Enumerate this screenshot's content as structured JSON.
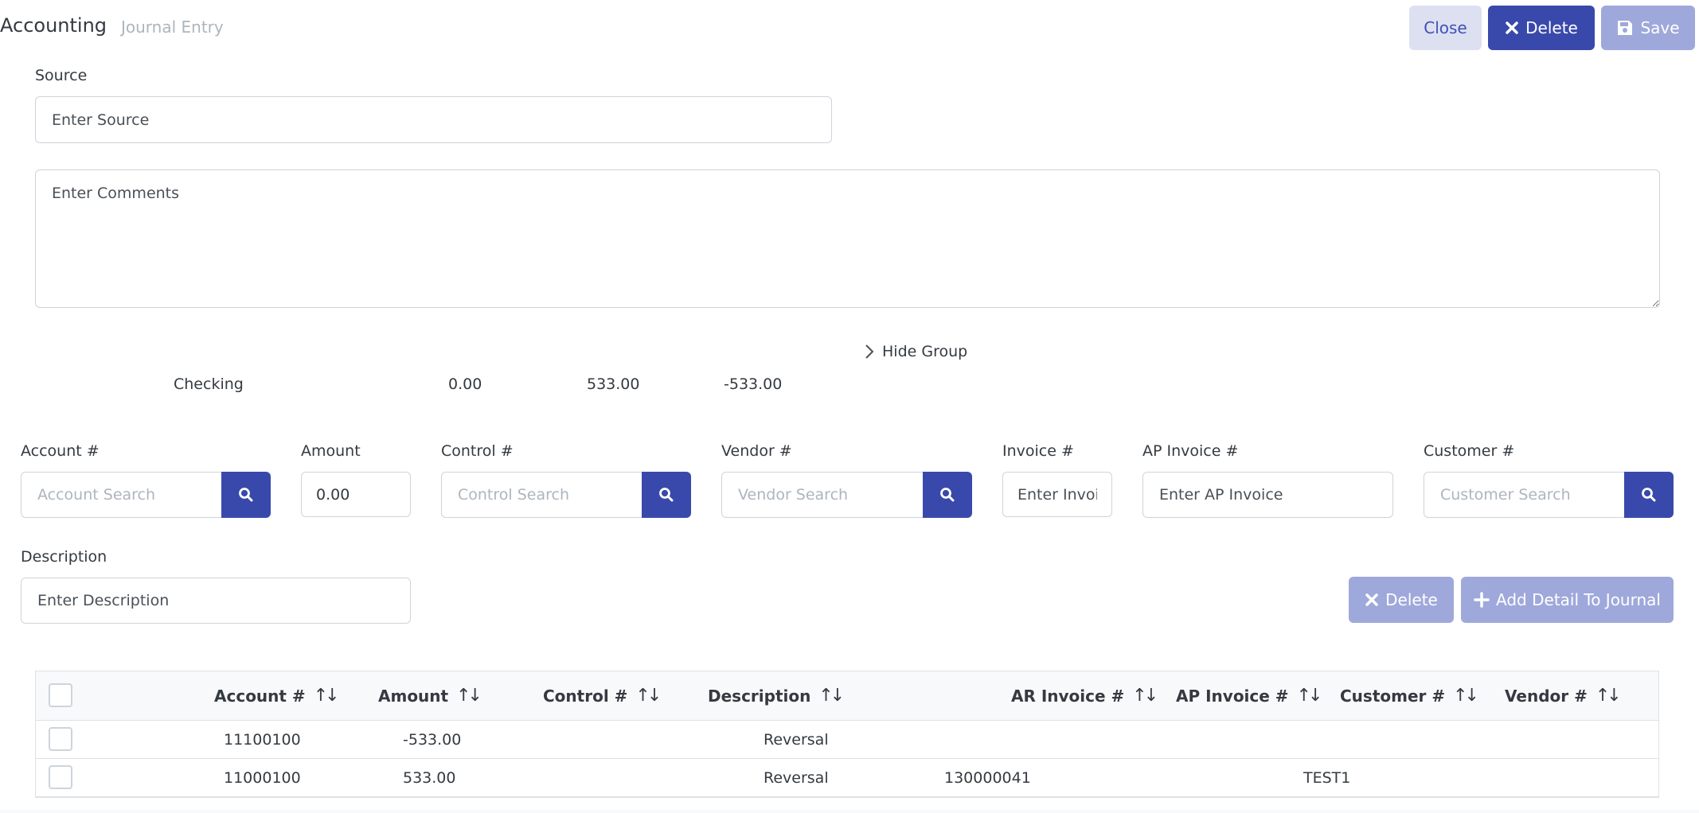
{
  "header": {
    "breadcrumb_main": "Accounting",
    "breadcrumb_sub": "Journal Entry",
    "close_label": "Close",
    "delete_label": "Delete",
    "save_label": "Save"
  },
  "form": {
    "source_label": "Source",
    "source_placeholder": "Enter Source",
    "comments_placeholder": "Enter Comments",
    "hide_group_label": "Hide Group"
  },
  "summary": {
    "account": "Checking",
    "value1": "0.00",
    "value2": "533.00",
    "value3": "-533.00"
  },
  "detail": {
    "account_label": "Account #",
    "account_placeholder": "Account Search",
    "amount_label": "Amount",
    "amount_value": "0.00",
    "control_label": "Control #",
    "control_placeholder": "Control Search",
    "vendor_label": "Vendor #",
    "vendor_placeholder": "Vendor Search",
    "invoice_label": "Invoice #",
    "invoice_placeholder": "Enter Invoice",
    "ap_invoice_label": "AP Invoice #",
    "ap_invoice_placeholder": "Enter AP Invoice",
    "customer_label": "Customer #",
    "customer_placeholder": "Customer Search",
    "description_label": "Description",
    "description_placeholder": "Enter Description",
    "delete_label": "Delete",
    "add_label": "Add Detail To Journal"
  },
  "table": {
    "columns": [
      "Account #",
      "Amount",
      "Control #",
      "Description",
      "AR Invoice #",
      "AP Invoice #",
      "Customer #",
      "Vendor #"
    ],
    "sort_glyph": "↑↓",
    "rows": [
      {
        "account": "11100100",
        "amount": "-533.00",
        "control": "",
        "description": "Reversal",
        "ar_invoice": "",
        "ap_invoice": "",
        "customer": "",
        "vendor": ""
      },
      {
        "account": "11000100",
        "amount": "533.00",
        "control": "",
        "description": "Reversal",
        "ar_invoice": "130000041",
        "ap_invoice": "",
        "customer": "TEST1",
        "vendor": ""
      }
    ]
  },
  "colors": {
    "primary": "#3949ab",
    "primary_light": "#9fa8da",
    "close_bg": "#dde0f1"
  }
}
